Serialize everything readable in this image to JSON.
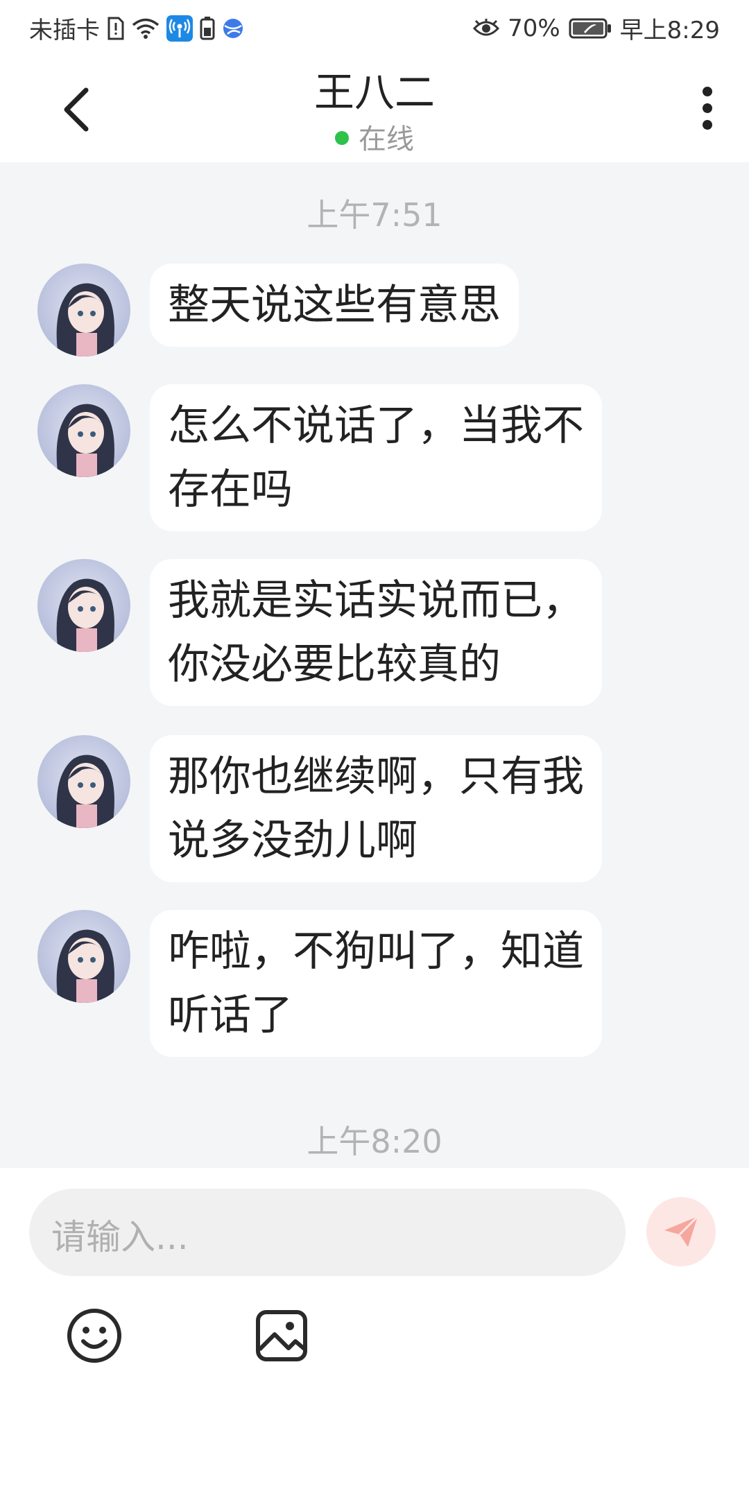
{
  "status_bar": {
    "carrier": "未插卡",
    "battery_percent": "70%",
    "time": "早上8:29"
  },
  "header": {
    "title": "王八二",
    "presence": "在线"
  },
  "chat": {
    "timestamp_1": "上午7:51",
    "messages": [
      {
        "line1": "整天说这些有意思",
        "line2": ""
      },
      {
        "line1": "怎么不说话了，当我不",
        "line2": "存在吗"
      },
      {
        "line1": "我就是实话实说而已，",
        "line2": "你没必要比较真的"
      },
      {
        "line1": "那你也继续啊，只有我",
        "line2": "说多没劲儿啊"
      },
      {
        "line1": "咋啦，不狗叫了，知道",
        "line2": "听话了"
      }
    ],
    "timestamp_2": "上午8:20"
  },
  "composer": {
    "placeholder": "请输入..."
  },
  "colors": {
    "online_dot": "#2ec24a",
    "chat_bg": "#f4f5f7",
    "send_button": "#fde7e5",
    "send_icon": "#f5a79e"
  },
  "icons": [
    "sim-missing-icon",
    "wifi-icon",
    "hotspot-icon",
    "battery-saver-icon",
    "browser-icon",
    "eye-icon",
    "battery-icon",
    "back-icon",
    "more-vertical-icon",
    "send-icon",
    "emoji-icon",
    "image-icon"
  ]
}
